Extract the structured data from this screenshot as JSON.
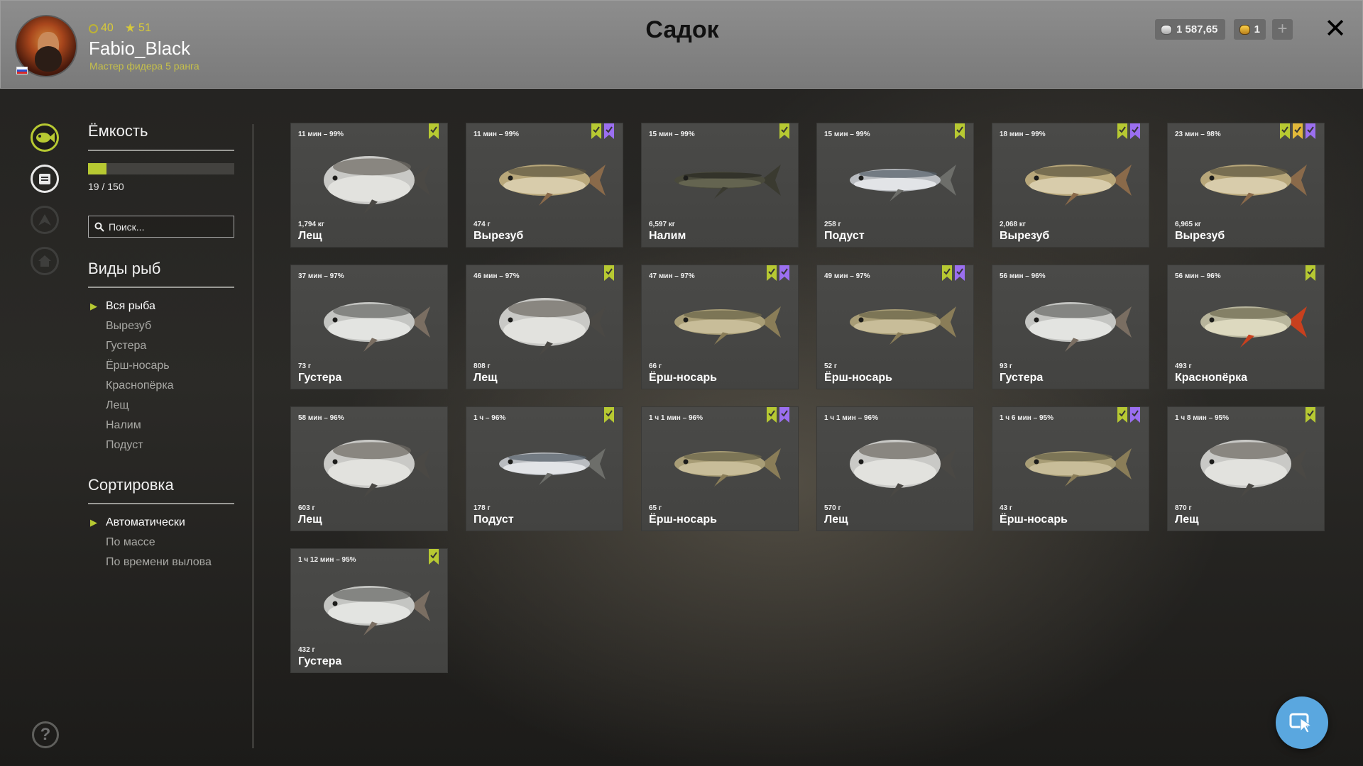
{
  "header": {
    "title": "Садок",
    "player": {
      "level": "40",
      "stars": "51",
      "name": "Fabio_Black",
      "rank": "Мастер фидера 5 ранга",
      "flag": "russia-flag"
    },
    "currency": {
      "silver": "1 587,65",
      "gold": "1"
    },
    "add_label": "+",
    "close_label": "✕"
  },
  "sidebar": {
    "capacity_title": "Ёмкость",
    "capacity_text": "19 / 150",
    "capacity_fraction": 0.127,
    "search_placeholder": "Поиск...",
    "species_title": "Виды рыб",
    "species": [
      "Вся рыба",
      "Вырезуб",
      "Густера",
      "Ёрш-носарь",
      "Краснопёрка",
      "Лещ",
      "Налим",
      "Подуст"
    ],
    "species_active": 0,
    "sort_title": "Сортировка",
    "sort_options": [
      "Автоматически",
      "По массе",
      "По времени вылова"
    ],
    "sort_active": 0,
    "help_label": "?"
  },
  "colors": {
    "accent_green": "#b7c932",
    "accent_purple": "#9b6ff0",
    "accent_gold": "#e2b93a",
    "fab_blue": "#5aa7df"
  },
  "fish": [
    {
      "time": "11 мин – 99%",
      "weight": "1,794 кг",
      "name": "Лещ",
      "marks": [
        "green"
      ]
    },
    {
      "time": "11 мин – 99%",
      "weight": "474 г",
      "name": "Вырезуб",
      "marks": [
        "green",
        "purple"
      ]
    },
    {
      "time": "15 мин – 99%",
      "weight": "6,597 кг",
      "name": "Налим",
      "marks": [
        "green"
      ]
    },
    {
      "time": "15 мин – 99%",
      "weight": "258 г",
      "name": "Подуст",
      "marks": [
        "green"
      ]
    },
    {
      "time": "18 мин – 99%",
      "weight": "2,068 кг",
      "name": "Вырезуб",
      "marks": [
        "green",
        "purple"
      ]
    },
    {
      "time": "23 мин – 98%",
      "weight": "6,965 кг",
      "name": "Вырезуб",
      "marks": [
        "green",
        "gold",
        "purple"
      ]
    },
    {
      "time": "37 мин – 97%",
      "weight": "73 г",
      "name": "Густера",
      "marks": []
    },
    {
      "time": "46 мин – 97%",
      "weight": "808 г",
      "name": "Лещ",
      "marks": [
        "green"
      ]
    },
    {
      "time": "47 мин – 97%",
      "weight": "66 г",
      "name": "Ёрш-носарь",
      "marks": [
        "green",
        "purple"
      ]
    },
    {
      "time": "49 мин – 97%",
      "weight": "52 г",
      "name": "Ёрш-носарь",
      "marks": [
        "green",
        "purple"
      ]
    },
    {
      "time": "56 мин – 96%",
      "weight": "93 г",
      "name": "Густера",
      "marks": []
    },
    {
      "time": "56 мин – 96%",
      "weight": "493 г",
      "name": "Краснопёрка",
      "marks": [
        "green"
      ]
    },
    {
      "time": "58 мин – 96%",
      "weight": "603 г",
      "name": "Лещ",
      "marks": []
    },
    {
      "time": "1 ч – 96%",
      "weight": "178 г",
      "name": "Подуст",
      "marks": [
        "green"
      ]
    },
    {
      "time": "1 ч 1 мин – 96%",
      "weight": "65 г",
      "name": "Ёрш-носарь",
      "marks": [
        "green",
        "purple"
      ]
    },
    {
      "time": "1 ч 1 мин – 96%",
      "weight": "570 г",
      "name": "Лещ",
      "marks": []
    },
    {
      "time": "1 ч 6 мин – 95%",
      "weight": "43 г",
      "name": "Ёрш-носарь",
      "marks": [
        "green",
        "purple"
      ]
    },
    {
      "time": "1 ч 8 мин – 95%",
      "weight": "870 г",
      "name": "Лещ",
      "marks": [
        "green"
      ]
    },
    {
      "time": "1 ч 12 мин – 95%",
      "weight": "432 г",
      "name": "Густера",
      "marks": [
        "green"
      ]
    }
  ]
}
